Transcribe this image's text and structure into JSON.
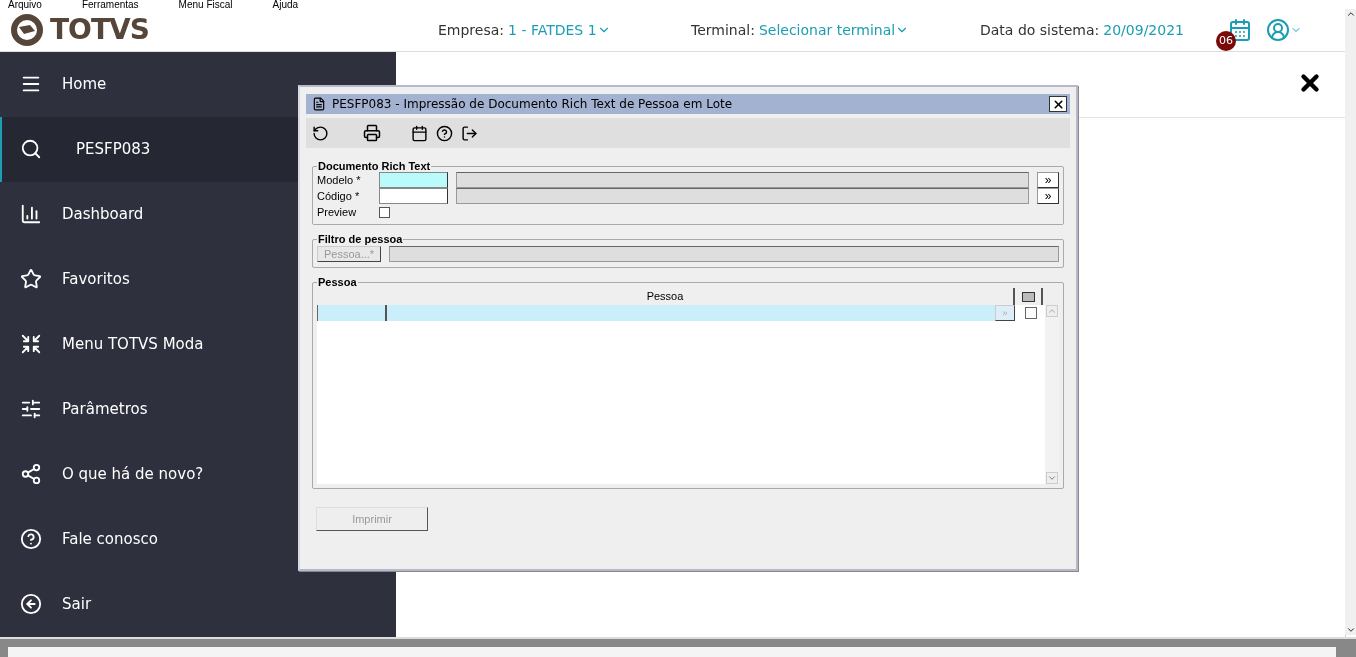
{
  "menu_bar": [
    "Arquivo",
    "Ferramentas",
    "Menu Fiscal",
    "Ajuda"
  ],
  "header": {
    "logo": "TOTVS",
    "empresa_label": "Empresa:",
    "empresa_value": "1 - FATDES 1",
    "terminal_label": "Terminal:",
    "terminal_value": "Selecionar terminal",
    "date_label": "Data do sistema:",
    "date_value": "20/09/2021",
    "calendar_badge": "06"
  },
  "sidebar": {
    "items": [
      {
        "kind": "menu",
        "label": "Home",
        "selected": false
      },
      {
        "kind": "search",
        "label": "PESFP083",
        "selected": true
      },
      {
        "kind": "dashboard",
        "label": "Dashboard",
        "selected": false
      },
      {
        "kind": "favorites",
        "label": "Favoritos",
        "selected": false
      },
      {
        "kind": "shrink",
        "label": "Menu TOTVS Moda",
        "selected": false
      },
      {
        "kind": "sliders",
        "label": "Parâmetros",
        "selected": false
      },
      {
        "kind": "share",
        "label": "O que há de novo?",
        "selected": false
      },
      {
        "kind": "help",
        "label": "Fale conosco",
        "selected": false
      },
      {
        "kind": "exit",
        "label": "Sair",
        "selected": false
      }
    ]
  },
  "dialog": {
    "title": "PESFP083 - Impressão de Documento Rich Text de Pessoa em Lote",
    "documento": {
      "legend": "Documento Rich Text",
      "fields": [
        {
          "label": "Modelo *",
          "focused": true,
          "lookup_button": "»"
        },
        {
          "label": "Código *",
          "focused": false,
          "lookup_button": "»"
        }
      ],
      "preview": {
        "label": "Preview",
        "checked": false
      }
    },
    "filtro": {
      "legend": "Filtro de pessoa",
      "button": {
        "label": "Pessoa...*",
        "disabled": true
      }
    },
    "pessoa": {
      "legend": "Pessoa",
      "column": "Pessoa",
      "rows": [
        {
          "selected": true,
          "checked": false,
          "lookup_button": "»"
        }
      ]
    },
    "print_button": {
      "label": "Imprimir",
      "disabled": true
    }
  }
}
